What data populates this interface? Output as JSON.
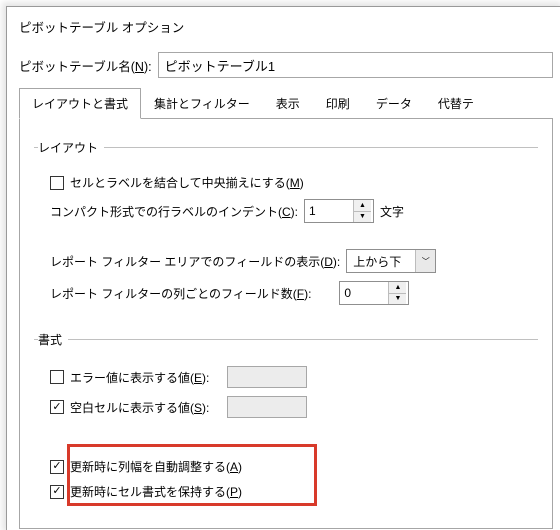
{
  "title": "ピボットテーブル オプション",
  "name_label_pre": "ピボットテーブル名(",
  "name_label_u": "N",
  "name_label_post": "):",
  "name_value": "ピボットテーブル1",
  "tabs": {
    "t0": "レイアウトと書式",
    "t1": "集計とフィルター",
    "t2": "表示",
    "t3": "印刷",
    "t4": "データ",
    "t5": "代替テ"
  },
  "layout": {
    "legend": "レイアウト",
    "merge_label_pre": "セルとラベルを結合して中央揃えにする(",
    "merge_label_u": "M",
    "merge_label_post": ")",
    "indent_label_pre": "コンパクト形式での行ラベルのインデント(",
    "indent_label_u": "C",
    "indent_label_post": "):",
    "indent_value": "1",
    "indent_suffix": "文字",
    "rf_display_label_pre": "レポート フィルター エリアでのフィールドの表示(",
    "rf_display_label_u": "D",
    "rf_display_label_post": "):",
    "rf_display_value": "上から下",
    "rf_count_label_pre": "レポート フィルターの列ごとのフィールド数(",
    "rf_count_label_u": "F",
    "rf_count_label_post": "):",
    "rf_count_value": "0"
  },
  "format": {
    "legend": "書式",
    "err_label_pre": "エラー値に表示する値(",
    "err_label_u": "E",
    "err_label_post": "):",
    "empty_label_pre": "空白セルに表示する値(",
    "empty_label_u": "S",
    "empty_label_post": "):",
    "autofit_label_pre": "更新時に列幅を自動調整する(",
    "autofit_label_u": "A",
    "autofit_label_post": ")",
    "preserve_label_pre": "更新時にセル書式を保持する(",
    "preserve_label_u": "P",
    "preserve_label_post": ")"
  }
}
